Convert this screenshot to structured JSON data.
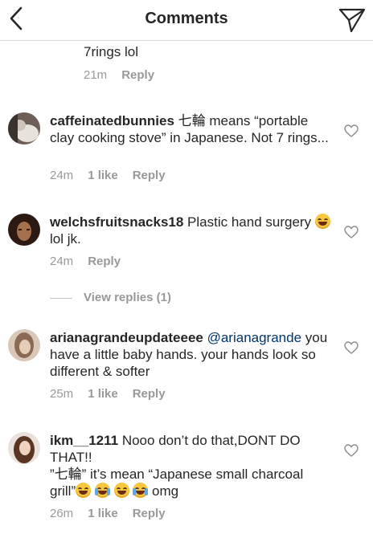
{
  "header": {
    "title": "Comments",
    "back_icon": "chevron-left-icon",
    "send_icon": "paper-plane-icon"
  },
  "comments": [
    {
      "username": "",
      "text": "7rings lol",
      "time": "21m",
      "likes": "",
      "reply": "Reply"
    },
    {
      "username": "caffeinatedbunnies",
      "text": "七輪 means “portable clay cooking stove” in Japanese. Not 7 rings...",
      "time": "24m",
      "likes": "1 like",
      "reply": "Reply"
    },
    {
      "username": "welchsfruitsnacks18",
      "text_before": "Plastic hand surgery",
      "text_after": "lol jk.",
      "time": "24m",
      "likes": "",
      "reply": "Reply"
    },
    {
      "username": "arianagrandeupdateeee",
      "mention": "@arianagrande",
      "text": "you have a little baby hands. your hands look so different & softer",
      "time": "25m",
      "likes": "1 like",
      "reply": "Reply"
    },
    {
      "username": "ikm__1211",
      "text_line1": "Nooo don’t do that,DONT DO THAT!!",
      "text_line2": "”七輪” it’s mean “Japanese small charcoal grill”",
      "text_after": "omg",
      "time": "26m",
      "likes": "1 like",
      "reply": "Reply"
    }
  ],
  "view_replies": "View replies (1)",
  "colors": {
    "username": "#262626",
    "meta": "#999999",
    "mention": "#003569",
    "divider": "#dbdbdb"
  }
}
